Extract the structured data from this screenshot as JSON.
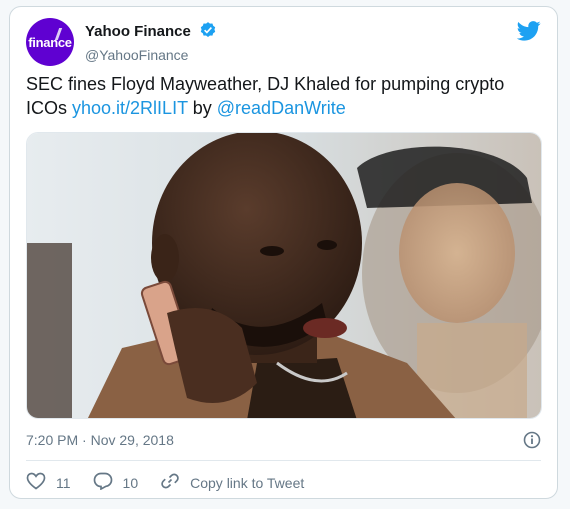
{
  "account": {
    "avatar_text": "finance",
    "display_name": "Yahoo Finance",
    "handle": "@YahooFinance"
  },
  "tweet": {
    "text_main": "SEC fines Floyd Mayweather, DJ Khaled for pumping crypto ICOs ",
    "link_text": "yhoo.it/2RlILIT",
    "by_text": " by ",
    "mention": "@readDanWrite",
    "timestamp": "7:20 PM · Nov 29, 2018"
  },
  "actions": {
    "like_count": "11",
    "reply_count": "10",
    "copy_link_label": "Copy link to Tweet"
  },
  "colors": {
    "brand_purple": "#5f01d1",
    "twitter_blue": "#1da1f2",
    "link_blue": "#1b95e0",
    "muted": "#657786"
  },
  "icons": [
    "verified-badge-icon",
    "twitter-bird-icon",
    "info-icon",
    "heart-icon",
    "reply-icon",
    "link-icon"
  ]
}
